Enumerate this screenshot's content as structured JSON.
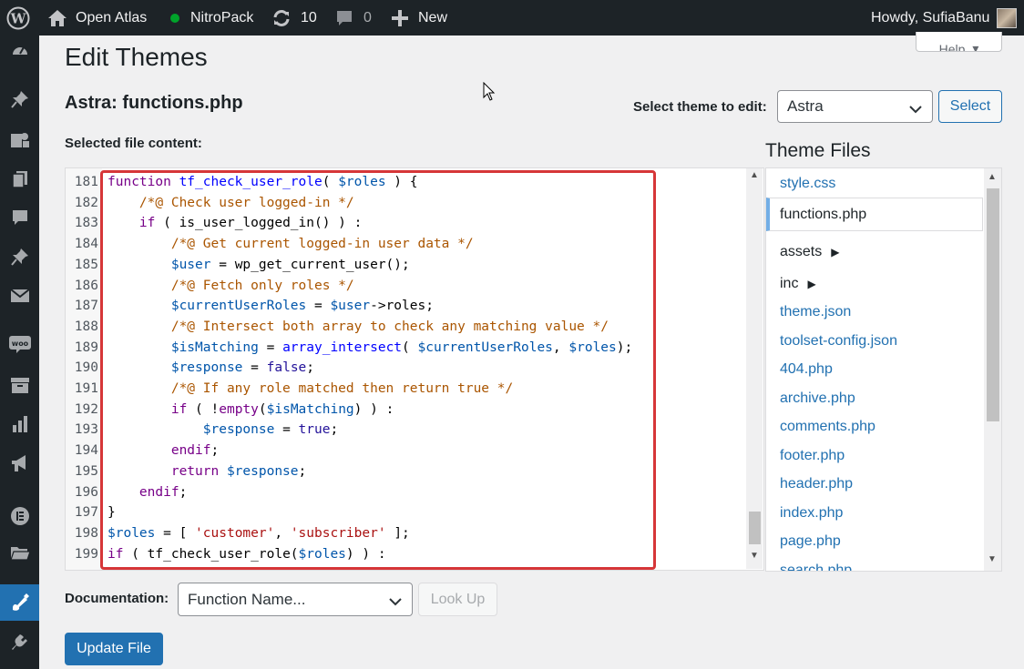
{
  "admin_bar": {
    "site_name": "Open Atlas",
    "nitropack": "NitroPack",
    "updates_count": "10",
    "comments_count": "0",
    "new_label": "New",
    "greeting": "Howdy, SufiaBanu"
  },
  "side_menu": {
    "icons": [
      "dashboard-icon",
      "pin-icon",
      "media-icon",
      "pages-icon",
      "comments-icon",
      "pin-icon",
      "mail-icon",
      "woocommerce-icon",
      "products-icon",
      "analytics-icon",
      "marketing-icon",
      "elementor-icon",
      "folders-icon",
      "appearance-icon",
      "plugins-icon"
    ],
    "current": "appearance-icon"
  },
  "page": {
    "help_label": "Help",
    "title": "Edit Themes",
    "file_title": "Astra: functions.php",
    "select_theme_label": "Select theme to edit:",
    "selected_theme": "Astra",
    "select_button": "Select",
    "content_label": "Selected file content:"
  },
  "code_lines": [
    {
      "n": "181",
      "tokens": [
        [
          "kw",
          "function "
        ],
        [
          "fn",
          "tf_check_user_role"
        ],
        [
          "txt",
          "( "
        ],
        [
          "var",
          "$roles"
        ],
        [
          "txt",
          " ) {"
        ]
      ]
    },
    {
      "n": "182",
      "tokens": [
        [
          "txt",
          "    "
        ],
        [
          "cmt",
          "/*@ Check user logged-in */"
        ]
      ]
    },
    {
      "n": "183",
      "tokens": [
        [
          "txt",
          "    "
        ],
        [
          "kw",
          "if"
        ],
        [
          "txt",
          " ( is_user_logged_in() ) :"
        ]
      ]
    },
    {
      "n": "184",
      "tokens": [
        [
          "txt",
          "        "
        ],
        [
          "cmt",
          "/*@ Get current logged-in user data */"
        ]
      ]
    },
    {
      "n": "185",
      "tokens": [
        [
          "txt",
          "        "
        ],
        [
          "var",
          "$user"
        ],
        [
          "txt",
          " = wp_get_current_user();"
        ]
      ]
    },
    {
      "n": "186",
      "tokens": [
        [
          "txt",
          "        "
        ],
        [
          "cmt",
          "/*@ Fetch only roles */"
        ]
      ]
    },
    {
      "n": "187",
      "tokens": [
        [
          "txt",
          "        "
        ],
        [
          "var",
          "$currentUserRoles"
        ],
        [
          "txt",
          " = "
        ],
        [
          "var",
          "$user"
        ],
        [
          "txt",
          "->roles;"
        ]
      ]
    },
    {
      "n": "188",
      "tokens": [
        [
          "txt",
          "        "
        ],
        [
          "cmt",
          "/*@ Intersect both array to check any matching value */"
        ]
      ]
    },
    {
      "n": "189",
      "tokens": [
        [
          "txt",
          "        "
        ],
        [
          "var",
          "$isMatching"
        ],
        [
          "txt",
          " = "
        ],
        [
          "fn",
          "array_intersect"
        ],
        [
          "txt",
          "( "
        ],
        [
          "var",
          "$currentUserRoles"
        ],
        [
          "txt",
          ", "
        ],
        [
          "var",
          "$roles"
        ],
        [
          "txt",
          ");"
        ]
      ]
    },
    {
      "n": "190",
      "tokens": [
        [
          "txt",
          "        "
        ],
        [
          "var",
          "$response"
        ],
        [
          "txt",
          " = "
        ],
        [
          "atom",
          "false"
        ],
        [
          "txt",
          ";"
        ]
      ]
    },
    {
      "n": "191",
      "tokens": [
        [
          "txt",
          "        "
        ],
        [
          "cmt",
          "/*@ If any role matched then return true */"
        ]
      ]
    },
    {
      "n": "192",
      "tokens": [
        [
          "txt",
          "        "
        ],
        [
          "kw",
          "if"
        ],
        [
          "txt",
          " ( !"
        ],
        [
          "kw",
          "empty"
        ],
        [
          "txt",
          "("
        ],
        [
          "var",
          "$isMatching"
        ],
        [
          "txt",
          ") ) :"
        ]
      ]
    },
    {
      "n": "193",
      "tokens": [
        [
          "txt",
          "            "
        ],
        [
          "var",
          "$response"
        ],
        [
          "txt",
          " = "
        ],
        [
          "atom",
          "true"
        ],
        [
          "txt",
          ";"
        ]
      ]
    },
    {
      "n": "194",
      "tokens": [
        [
          "txt",
          "        "
        ],
        [
          "kw",
          "endif"
        ],
        [
          "txt",
          ";"
        ]
      ]
    },
    {
      "n": "195",
      "tokens": [
        [
          "txt",
          "        "
        ],
        [
          "kw",
          "return "
        ],
        [
          "var",
          "$response"
        ],
        [
          "txt",
          ";"
        ]
      ]
    },
    {
      "n": "196",
      "tokens": [
        [
          "txt",
          "    "
        ],
        [
          "kw",
          "endif"
        ],
        [
          "txt",
          ";"
        ]
      ]
    },
    {
      "n": "197",
      "tokens": [
        [
          "txt",
          "}"
        ]
      ]
    },
    {
      "n": "198",
      "tokens": [
        [
          "var",
          "$roles"
        ],
        [
          "txt",
          " = [ "
        ],
        [
          "str",
          "'customer'"
        ],
        [
          "txt",
          ", "
        ],
        [
          "str",
          "'subscriber'"
        ],
        [
          "txt",
          " ];"
        ]
      ]
    },
    {
      "n": "199",
      "tokens": [
        [
          "kw",
          "if"
        ],
        [
          "txt",
          " ( tf_check_user_role("
        ],
        [
          "var",
          "$roles"
        ],
        [
          "txt",
          ") ) :"
        ]
      ]
    }
  ],
  "theme_files": {
    "title": "Theme Files",
    "items": [
      {
        "label": "style.css",
        "type": "file"
      },
      {
        "label": "functions.php",
        "type": "current"
      },
      {
        "label": "assets",
        "type": "folder"
      },
      {
        "label": "inc",
        "type": "folder"
      },
      {
        "label": "theme.json",
        "type": "file"
      },
      {
        "label": "toolset-config.json",
        "type": "file"
      },
      {
        "label": "404.php",
        "type": "file"
      },
      {
        "label": "archive.php",
        "type": "file"
      },
      {
        "label": "comments.php",
        "type": "file"
      },
      {
        "label": "footer.php",
        "type": "file"
      },
      {
        "label": "header.php",
        "type": "file"
      },
      {
        "label": "index.php",
        "type": "file"
      },
      {
        "label": "page.php",
        "type": "file"
      },
      {
        "label": "search.php",
        "type": "file"
      }
    ]
  },
  "documentation": {
    "label": "Documentation:",
    "placeholder_option": "Function Name...",
    "lookup_button": "Look Up"
  },
  "update_button": "Update File",
  "colors": {
    "admin_bar_bg": "#1d2327",
    "accent": "#2271b1",
    "highlight_border": "#d63638",
    "nitropack_dot": "#00a32a"
  }
}
